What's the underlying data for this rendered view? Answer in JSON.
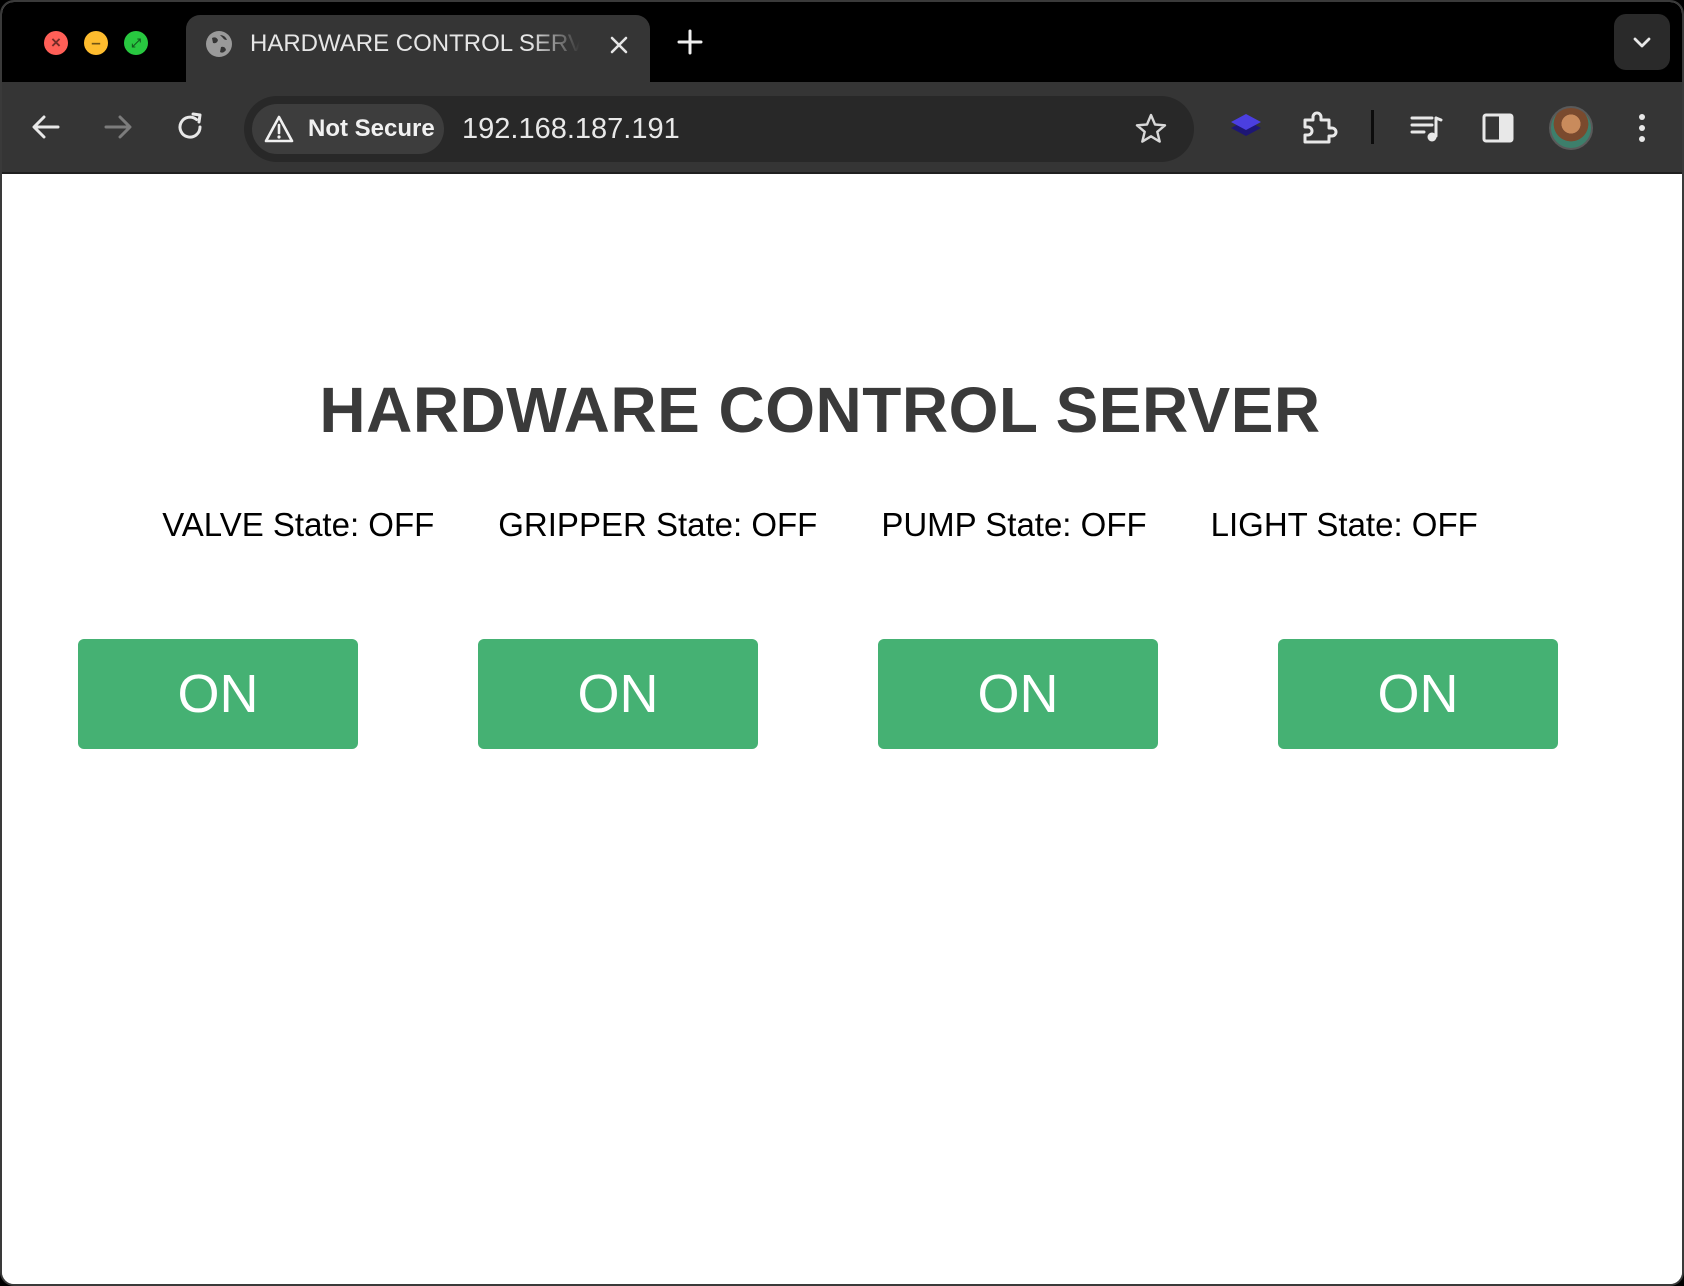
{
  "browser": {
    "tab": {
      "title": "HARDWARE CONTROL SERVER"
    },
    "omnibox": {
      "security_label": "Not Secure",
      "url": "192.168.187.191"
    }
  },
  "page": {
    "heading": "HARDWARE CONTROL SERVER",
    "devices": [
      {
        "state_text": "VALVE State: OFF",
        "button_label": "ON"
      },
      {
        "state_text": "GRIPPER State: OFF",
        "button_label": "ON"
      },
      {
        "state_text": "PUMP State: OFF",
        "button_label": "ON"
      },
      {
        "state_text": "LIGHT State: OFF",
        "button_label": "ON"
      }
    ]
  },
  "colors": {
    "button_green": "#45b173",
    "heading_gray": "#3a3a3a"
  },
  "icons": [
    "globe-icon",
    "close-icon",
    "plus-icon",
    "chevron-down-icon",
    "back-arrow-icon",
    "forward-arrow-icon",
    "reload-icon",
    "warning-icon",
    "star-icon",
    "extension-layers-icon",
    "puzzle-icon",
    "media-queue-icon",
    "side-panel-icon",
    "avatar",
    "kebab-menu-icon"
  ]
}
